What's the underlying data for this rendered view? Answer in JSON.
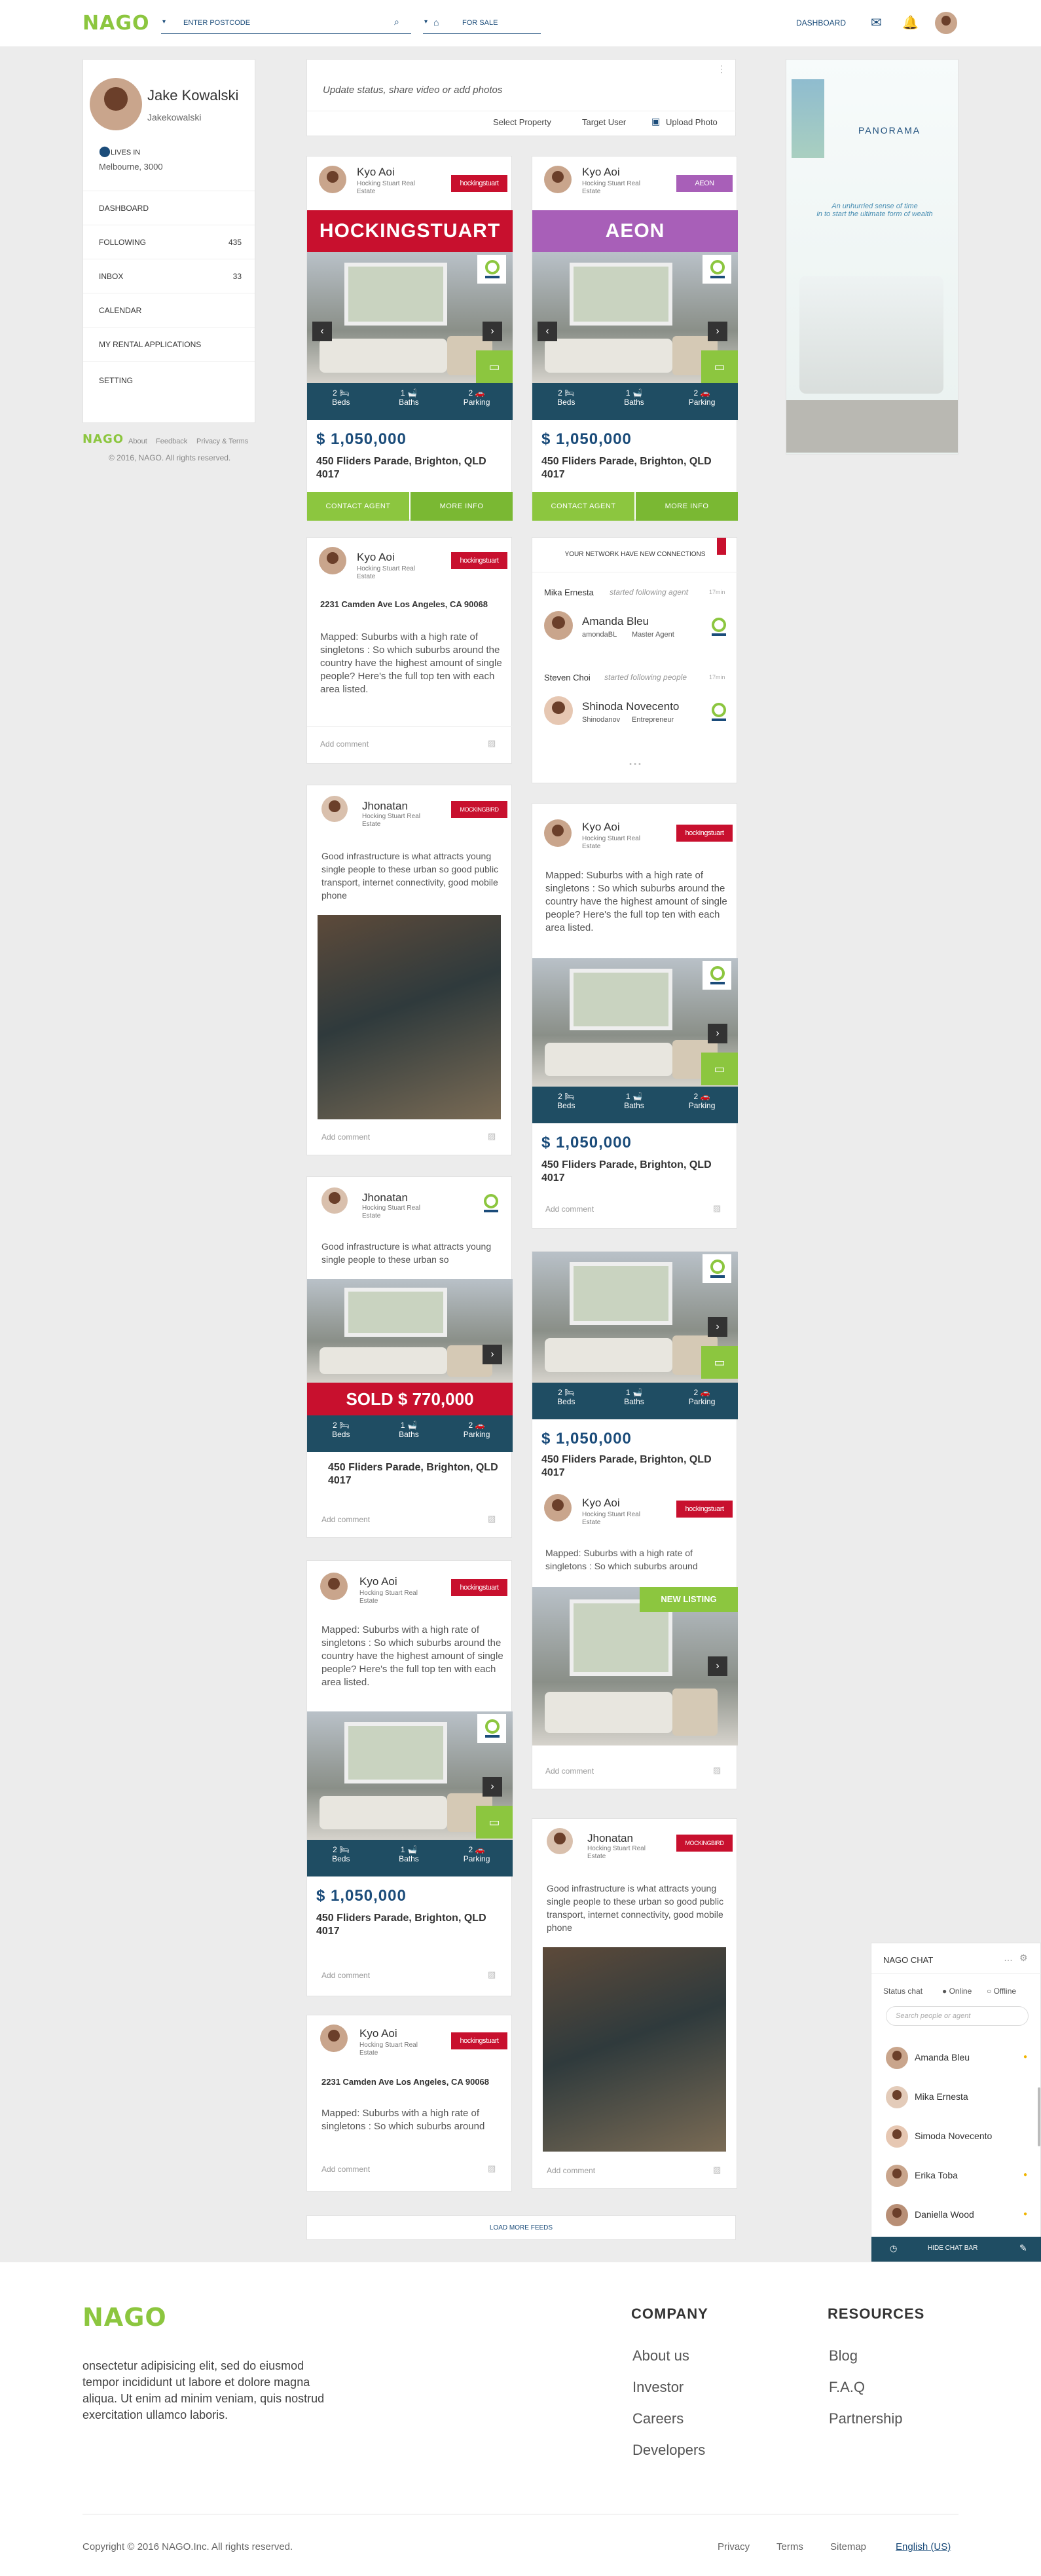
{
  "header": {
    "logo": "NAGO",
    "postcode_placeholder": "ENTER POSTCODE",
    "for_sale": "FOR SALE",
    "dashboard": "DASHBOARD"
  },
  "profile": {
    "name": "Jake Kowalski",
    "username": "Jakekowalski",
    "lives_in_label": "LIVES IN",
    "location": "Melbourne, 3000",
    "menu": [
      {
        "label": "DASHBOARD",
        "count": ""
      },
      {
        "label": "FOLLOWING",
        "count": "435"
      },
      {
        "label": "INBOX",
        "count": "33"
      },
      {
        "label": "CALENDAR",
        "count": ""
      },
      {
        "label": "MY RENTAL APPLICATIONS",
        "count": ""
      },
      {
        "label": "SETTING",
        "count": ""
      }
    ]
  },
  "left_footer": {
    "logo": "NAGO",
    "about": "About",
    "feedback": "Feedback",
    "privacy": "Privacy & Terms",
    "copyright": "© 2016, NAGO. All rights reserved."
  },
  "composer": {
    "placeholder": "Update status, share video or add photos",
    "select_property": "Select Property",
    "target_user": "Target User",
    "upload_photo": "Upload Photo"
  },
  "ad": {
    "brand": "PANORAMA",
    "tagline": "An unhurried sense of time\nin to start the ultimate form of wealth"
  },
  "listing_labels": {
    "beds": "Beds",
    "baths": "Baths",
    "parking": "Parking",
    "beds_count": "2",
    "baths_count": "1",
    "parking_count": "2",
    "contact_agent": "CONTACT AGENT",
    "more_info": "MORE INFO",
    "add_comment": "Add comment",
    "sold_banner": "SOLD $ 770,000",
    "new_listing": "NEW LISTING"
  },
  "agents": {
    "kyo": {
      "name": "Kyo Aoi",
      "company": "Hocking Stuart Real Estate",
      "tag": "hockingstuart"
    },
    "jhonatan": {
      "name": "Jhonatan",
      "company": "Hocking Stuart Real Estate",
      "tag": "MOCKINGBIRD"
    }
  },
  "feed": {
    "card1": {
      "banner": "HOCKINGSTUART",
      "price": "$ 1,050,000",
      "address": "450 Fliders Parade, Brighton, QLD 4017"
    },
    "card2": {
      "banner": "AEON",
      "tag": "AEON",
      "price": "$ 1,050,000",
      "address": "450 Fliders Parade, Brighton, QLD 4017"
    },
    "card3": {
      "address": "2231 Camden Ave Los Angeles, CA 90068",
      "text": "Mapped: Suburbs with a high rate of singletons : So which suburbs around the country have the highest amount of single people?  Here's the full top ten with each area listed."
    },
    "network": {
      "title": "YOUR NETWORK HAVE NEW CONNECTIONS",
      "row1_actor": "Mika Ernesta",
      "row1_action": "started following agent",
      "row1_time": "17min",
      "row1_name": "Amanda Bleu",
      "row1_user": "amondaBL",
      "row1_role": "Master Agent",
      "row2_actor": "Steven Choi",
      "row2_action": "started following people",
      "row2_time": "17min",
      "row2_name": "Shinoda Novecento",
      "row2_user": "Shinodanov",
      "row2_role": "Entrepreneur",
      "more": "• • •"
    },
    "card5": {
      "text": "Good infrastructure is what attracts young single people to these urban so good public transport,  internet connectivity, good mobile phone"
    },
    "card6": {
      "text": "Mapped: Suburbs with a high rate of singletons : So which suburbs around the country have the highest amount of single people?  Here's the full top ten with each area listed.",
      "price": "$ 1,050,000",
      "address": "450 Fliders Parade, Brighton, QLD 4017"
    },
    "card7": {
      "text": "Good infrastructure is what attracts young single people to these urban so",
      "address": "450 Fliders Parade, Brighton, QLD 4017"
    },
    "card8": {
      "price": "$ 1,050,000",
      "address": "450 Fliders Parade, Brighton, QLD 4017",
      "text": "Mapped: Suburbs with a high rate of singletons : So which suburbs around"
    },
    "card9": {
      "text": "Mapped: Suburbs with a high rate of singletons : So which suburbs around the country have the highest amount of single people?  Here's the full top ten with each area listed.",
      "price": "$ 1,050,000",
      "address": "450 Fliders Parade, Brighton, QLD 4017"
    },
    "card10": {
      "text": "Good infrastructure is what attracts young single people to these urban so good public transport,  internet connectivity, good mobile phone"
    },
    "card11": {
      "address": "2231 Camden Ave Los Angeles, CA 90068",
      "text": "Mapped: Suburbs with a high rate of singletons : So which suburbs around"
    },
    "load_more": "LOAD MORE FEEDS"
  },
  "chat": {
    "title": "NAGO CHAT",
    "status_label": "Status chat",
    "online": "Online",
    "offline": "Offline",
    "search_placeholder": "Search people or agent",
    "people": [
      "Amanda Bleu",
      "Mika Ernesta",
      "Simoda Novecento",
      "Erika Toba",
      "Daniella Wood"
    ],
    "hide": "HIDE CHAT BAR"
  },
  "footer": {
    "logo": "NAGO",
    "about": "onsectetur adipisicing elit, sed do eiusmod tempor incididunt ut labore et dolore magna aliqua. Ut enim ad minim veniam, quis nostrud exercitation ullamco laboris.",
    "company_title": "COMPANY",
    "company": [
      "About us",
      "Investor",
      "Careers",
      "Developers"
    ],
    "resources_title": "RESOURCES",
    "resources": [
      "Blog",
      "F.A.Q",
      "Partnership"
    ],
    "copyright": "Copyright © 2016 NAGO.Inc. All rights reserved.",
    "privacy": "Privacy",
    "terms": "Terms",
    "sitemap": "Sitemap",
    "language": "English (US)"
  },
  "colors": {
    "brand_blue": "#1b4c7a",
    "green": "#8cc63f",
    "red": "#c8102e",
    "purple": "#a85fb8"
  }
}
